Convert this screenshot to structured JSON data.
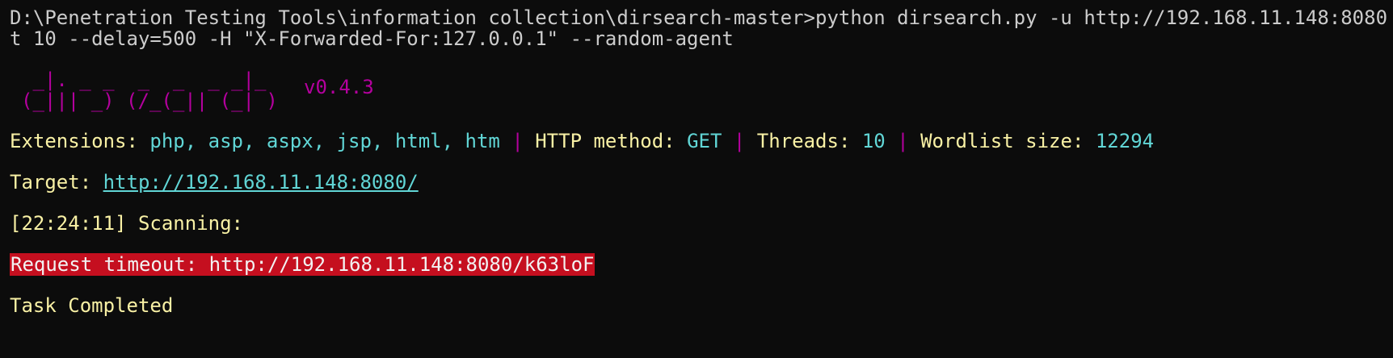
{
  "window": {
    "prompt": "D:\\Penetration Testing Tools\\information collection\\dirsearch-master>",
    "command_line1": "python dirsearch.py -u http://192.168.11.148:8080 -",
    "command_line2": "t 10 --delay=500 -H \"X-Forwarded-For:127.0.0.1\" --random-agent"
  },
  "banner": {
    "art_line1": " _|. _ _  _  _  _ _|_ ",
    "art_line2": "(_||| _) (/_(_|| (_| )",
    "version": "v0.4.3"
  },
  "config": {
    "extensions_label": "Extensions: ",
    "extensions_value": "php, asp, aspx, jsp, html, htm",
    "separator": " | ",
    "method_label": "HTTP method: ",
    "method_value": "GET",
    "threads_label": "Threads: ",
    "threads_value": "10",
    "wordlist_label": "Wordlist size: ",
    "wordlist_value": "12294"
  },
  "target": {
    "label": "Target: ",
    "url": "http://192.168.11.148:8080/"
  },
  "scan": {
    "timestamp": "[22:24:11]",
    "label": " Scanning:"
  },
  "error": {
    "message": "Request timeout: http://192.168.11.148:8080/k63loF"
  },
  "status": {
    "completed": "Task Completed"
  },
  "colors": {
    "background": "#0c0c0c",
    "yellow": "#f9f1a5",
    "cyan": "#61d6d6",
    "magenta": "#b4009e",
    "error_bg": "#c50f1f"
  }
}
